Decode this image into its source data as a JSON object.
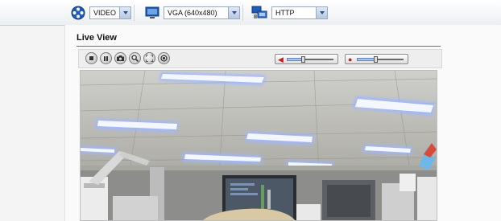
{
  "toolbar": {
    "stream_type": {
      "icon": "film-reel-icon",
      "value": "VIDEO"
    },
    "resolution": {
      "icon": "monitor-icon",
      "value": "VGA (640x480)"
    },
    "protocol": {
      "icon": "network-computer-icon",
      "value": "HTTP"
    }
  },
  "page": {
    "title": "Live View"
  },
  "controls": {
    "buttons": [
      "stop-icon",
      "pause-icon",
      "camera-snapshot-icon",
      "zoom-icon",
      "fullscreen-icon",
      "record-icon"
    ],
    "speaker_volume": {
      "icon": "speaker-icon",
      "level": 0.35
    },
    "mic_volume": {
      "icon": "microphone-icon",
      "level": 0.4
    }
  },
  "video": {
    "description_icon": "live-camera-feed"
  },
  "colors": {
    "accent": "#2c4f86",
    "mute": "#c02525"
  }
}
